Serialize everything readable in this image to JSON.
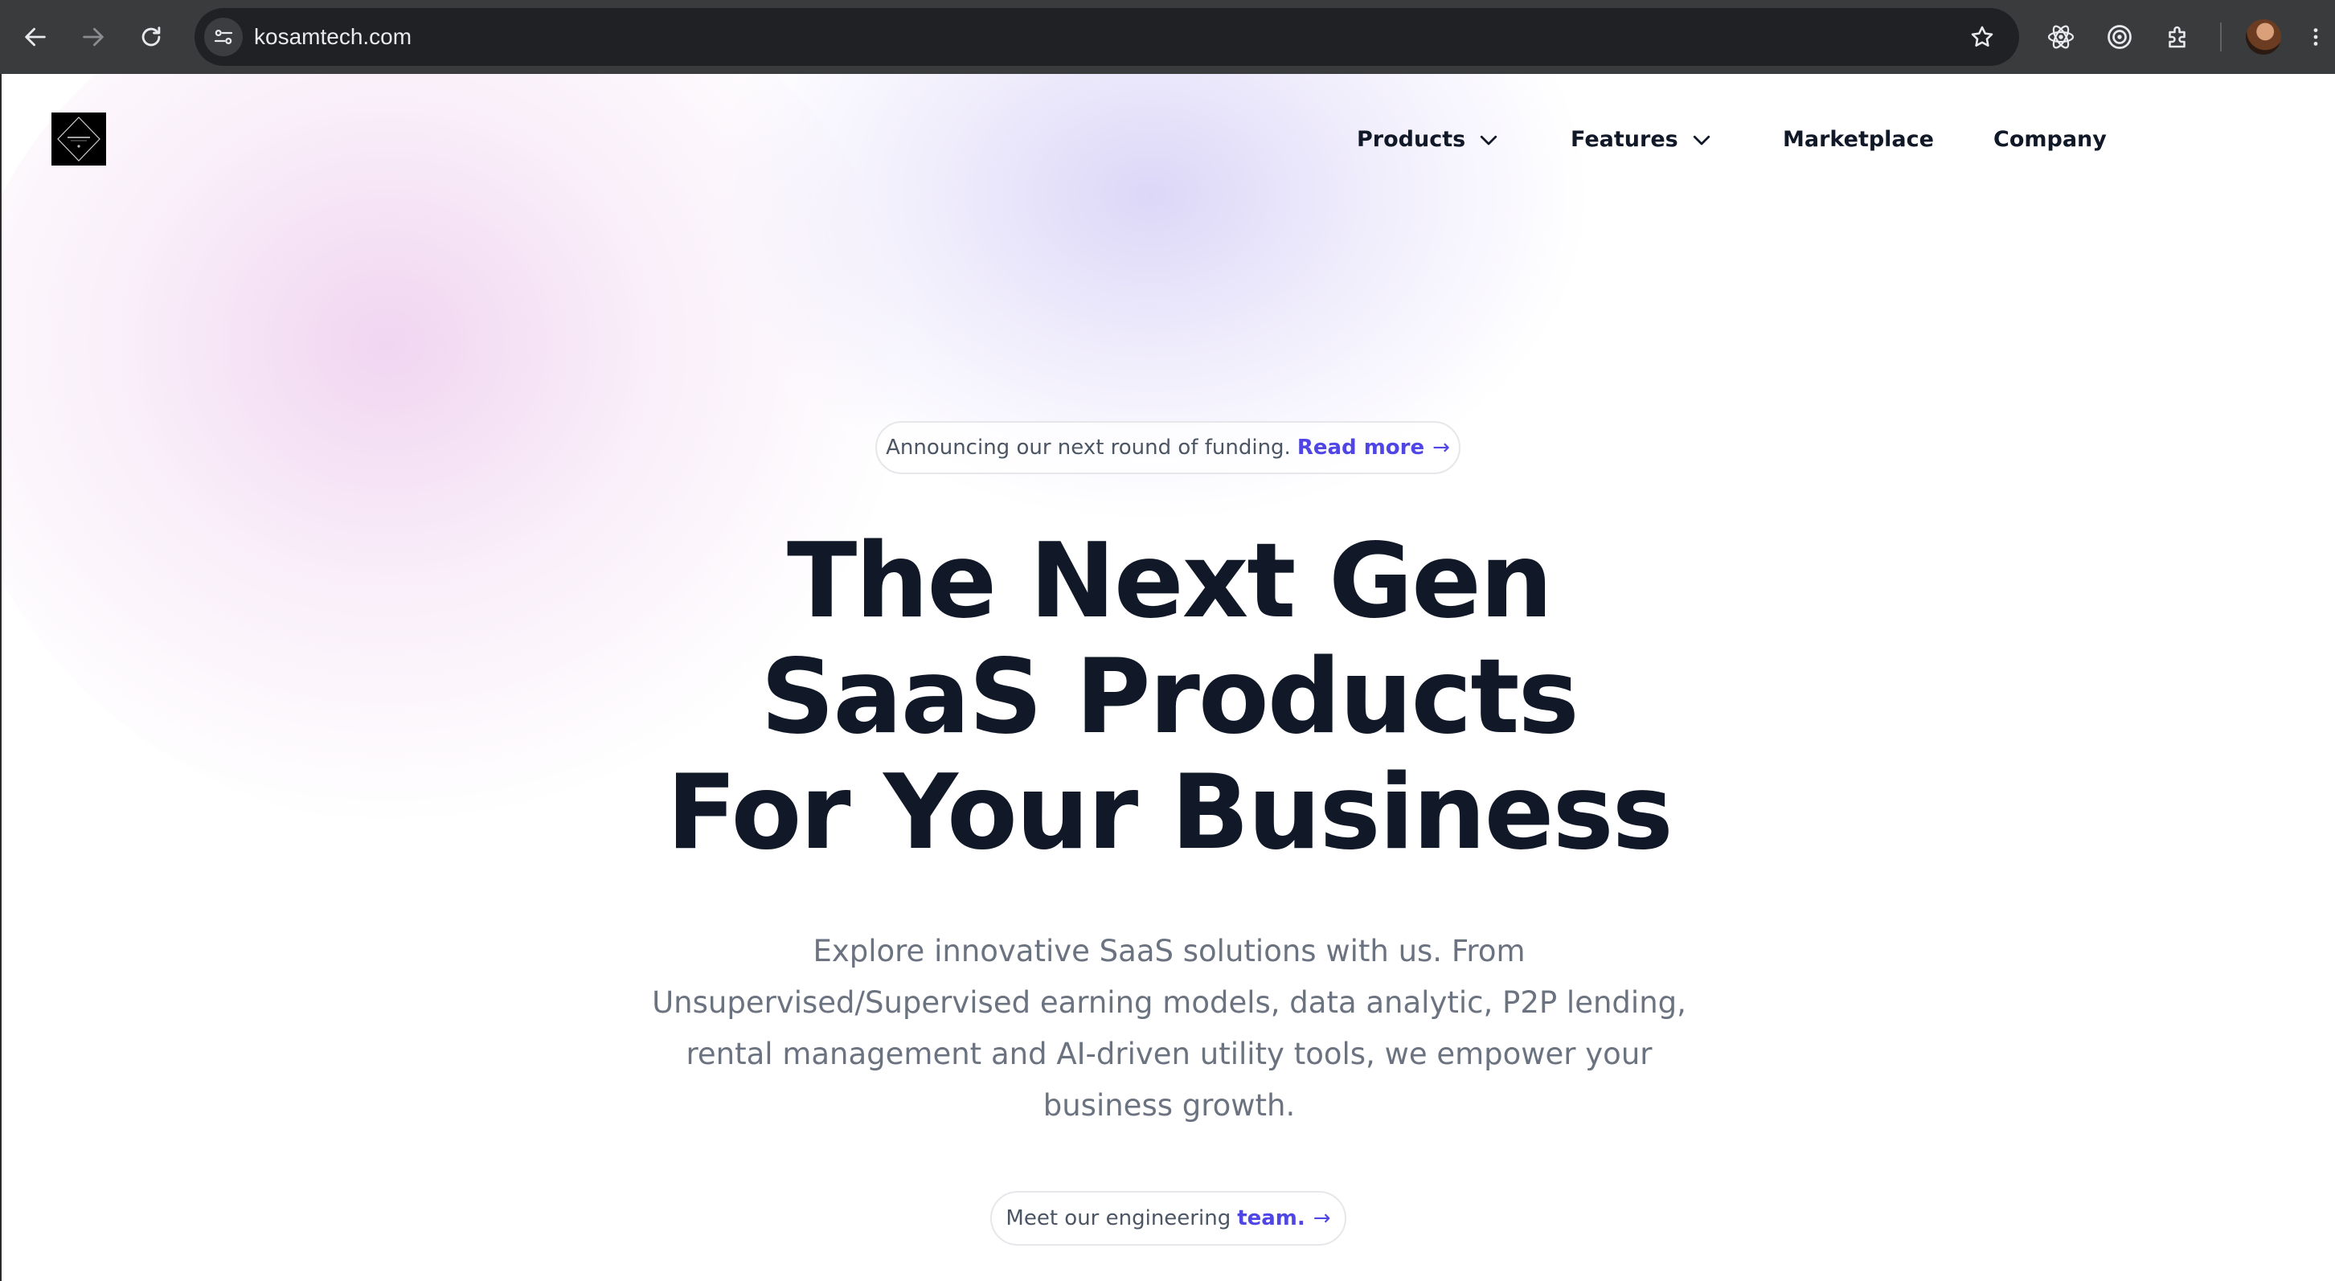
{
  "browser": {
    "url": "kosamtech.com",
    "colors": {
      "chrome_bg": "#3a3b3d",
      "omnibox_bg": "#202124",
      "url_text": "#e8eaed"
    },
    "icons": {
      "back": "arrow-left-icon",
      "forward": "arrow-right-icon",
      "reload": "reload-icon",
      "site_info": "tune-icon",
      "bookmark": "star-icon",
      "extension1": "react-icon",
      "extension2": "target-icon",
      "extensions": "puzzle-icon",
      "profile": "avatar",
      "menu": "kebab-menu-icon"
    }
  },
  "nav": {
    "logo": "KOSAM logo",
    "items": [
      {
        "label": "Products",
        "has_dropdown": true
      },
      {
        "label": "Features",
        "has_dropdown": true
      },
      {
        "label": "Marketplace",
        "has_dropdown": false
      },
      {
        "label": "Company",
        "has_dropdown": false
      }
    ]
  },
  "hero": {
    "announcement": {
      "text": "Announcing our next round of funding.",
      "link": "Read more",
      "arrow": "→"
    },
    "title_lines": [
      "The Next Gen",
      "SaaS Products",
      "For Your Business"
    ],
    "subtitle": "Explore innovative SaaS solutions with us. From Unsupervised/Supervised earning models, data analytic, P2P lending, rental management and AI-driven utility tools, we empower your business growth.",
    "team": {
      "text": "Meet our engineering",
      "link": "team.",
      "arrow": "→"
    }
  },
  "colors": {
    "heading": "#111827",
    "body_text": "#6b7280",
    "accent": "#4f46e5",
    "pill_border": "#e5e7eb"
  }
}
